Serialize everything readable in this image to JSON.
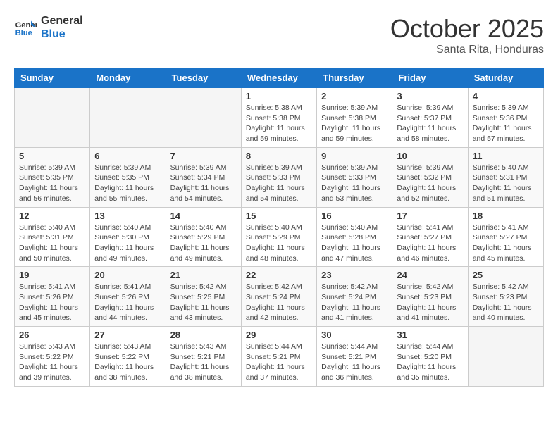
{
  "header": {
    "logo_line1": "General",
    "logo_line2": "Blue",
    "month": "October 2025",
    "location": "Santa Rita, Honduras"
  },
  "days_of_week": [
    "Sunday",
    "Monday",
    "Tuesday",
    "Wednesday",
    "Thursday",
    "Friday",
    "Saturday"
  ],
  "weeks": [
    [
      {
        "day": "",
        "info": ""
      },
      {
        "day": "",
        "info": ""
      },
      {
        "day": "",
        "info": ""
      },
      {
        "day": "1",
        "info": "Sunrise: 5:38 AM\nSunset: 5:38 PM\nDaylight: 11 hours and 59 minutes."
      },
      {
        "day": "2",
        "info": "Sunrise: 5:39 AM\nSunset: 5:38 PM\nDaylight: 11 hours and 59 minutes."
      },
      {
        "day": "3",
        "info": "Sunrise: 5:39 AM\nSunset: 5:37 PM\nDaylight: 11 hours and 58 minutes."
      },
      {
        "day": "4",
        "info": "Sunrise: 5:39 AM\nSunset: 5:36 PM\nDaylight: 11 hours and 57 minutes."
      }
    ],
    [
      {
        "day": "5",
        "info": "Sunrise: 5:39 AM\nSunset: 5:35 PM\nDaylight: 11 hours and 56 minutes."
      },
      {
        "day": "6",
        "info": "Sunrise: 5:39 AM\nSunset: 5:35 PM\nDaylight: 11 hours and 55 minutes."
      },
      {
        "day": "7",
        "info": "Sunrise: 5:39 AM\nSunset: 5:34 PM\nDaylight: 11 hours and 54 minutes."
      },
      {
        "day": "8",
        "info": "Sunrise: 5:39 AM\nSunset: 5:33 PM\nDaylight: 11 hours and 54 minutes."
      },
      {
        "day": "9",
        "info": "Sunrise: 5:39 AM\nSunset: 5:33 PM\nDaylight: 11 hours and 53 minutes."
      },
      {
        "day": "10",
        "info": "Sunrise: 5:39 AM\nSunset: 5:32 PM\nDaylight: 11 hours and 52 minutes."
      },
      {
        "day": "11",
        "info": "Sunrise: 5:40 AM\nSunset: 5:31 PM\nDaylight: 11 hours and 51 minutes."
      }
    ],
    [
      {
        "day": "12",
        "info": "Sunrise: 5:40 AM\nSunset: 5:31 PM\nDaylight: 11 hours and 50 minutes."
      },
      {
        "day": "13",
        "info": "Sunrise: 5:40 AM\nSunset: 5:30 PM\nDaylight: 11 hours and 49 minutes."
      },
      {
        "day": "14",
        "info": "Sunrise: 5:40 AM\nSunset: 5:29 PM\nDaylight: 11 hours and 49 minutes."
      },
      {
        "day": "15",
        "info": "Sunrise: 5:40 AM\nSunset: 5:29 PM\nDaylight: 11 hours and 48 minutes."
      },
      {
        "day": "16",
        "info": "Sunrise: 5:40 AM\nSunset: 5:28 PM\nDaylight: 11 hours and 47 minutes."
      },
      {
        "day": "17",
        "info": "Sunrise: 5:41 AM\nSunset: 5:27 PM\nDaylight: 11 hours and 46 minutes."
      },
      {
        "day": "18",
        "info": "Sunrise: 5:41 AM\nSunset: 5:27 PM\nDaylight: 11 hours and 45 minutes."
      }
    ],
    [
      {
        "day": "19",
        "info": "Sunrise: 5:41 AM\nSunset: 5:26 PM\nDaylight: 11 hours and 45 minutes."
      },
      {
        "day": "20",
        "info": "Sunrise: 5:41 AM\nSunset: 5:26 PM\nDaylight: 11 hours and 44 minutes."
      },
      {
        "day": "21",
        "info": "Sunrise: 5:42 AM\nSunset: 5:25 PM\nDaylight: 11 hours and 43 minutes."
      },
      {
        "day": "22",
        "info": "Sunrise: 5:42 AM\nSunset: 5:24 PM\nDaylight: 11 hours and 42 minutes."
      },
      {
        "day": "23",
        "info": "Sunrise: 5:42 AM\nSunset: 5:24 PM\nDaylight: 11 hours and 41 minutes."
      },
      {
        "day": "24",
        "info": "Sunrise: 5:42 AM\nSunset: 5:23 PM\nDaylight: 11 hours and 41 minutes."
      },
      {
        "day": "25",
        "info": "Sunrise: 5:42 AM\nSunset: 5:23 PM\nDaylight: 11 hours and 40 minutes."
      }
    ],
    [
      {
        "day": "26",
        "info": "Sunrise: 5:43 AM\nSunset: 5:22 PM\nDaylight: 11 hours and 39 minutes."
      },
      {
        "day": "27",
        "info": "Sunrise: 5:43 AM\nSunset: 5:22 PM\nDaylight: 11 hours and 38 minutes."
      },
      {
        "day": "28",
        "info": "Sunrise: 5:43 AM\nSunset: 5:21 PM\nDaylight: 11 hours and 38 minutes."
      },
      {
        "day": "29",
        "info": "Sunrise: 5:44 AM\nSunset: 5:21 PM\nDaylight: 11 hours and 37 minutes."
      },
      {
        "day": "30",
        "info": "Sunrise: 5:44 AM\nSunset: 5:21 PM\nDaylight: 11 hours and 36 minutes."
      },
      {
        "day": "31",
        "info": "Sunrise: 5:44 AM\nSunset: 5:20 PM\nDaylight: 11 hours and 35 minutes."
      },
      {
        "day": "",
        "info": ""
      }
    ]
  ]
}
